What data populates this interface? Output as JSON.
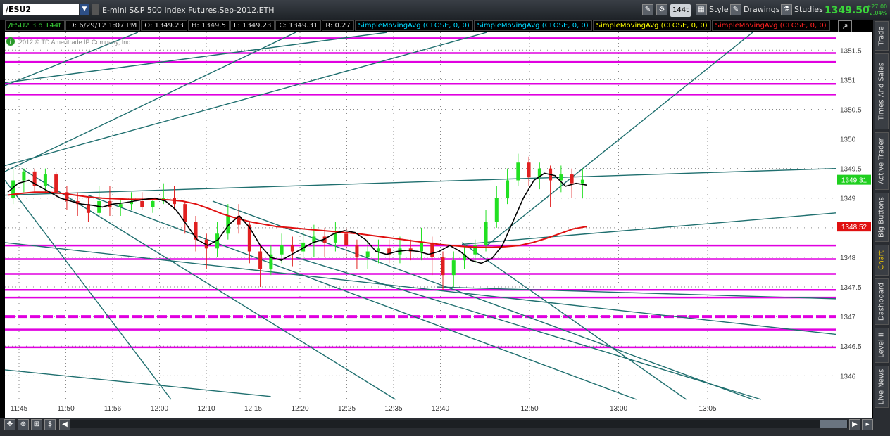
{
  "header": {
    "symbol": "/ESU2",
    "description": "E-mini S&P 500 Index Futures,Sep-2012,ETH",
    "ticks_label": "144t",
    "style_label": "Style",
    "drawings_label": "Drawings",
    "studies_label": "Studies",
    "last_price": "1349.50",
    "change_abs": "+27.00",
    "change_pct": "+2.04%"
  },
  "info_bar": {
    "symbol_period": "/ESU2 3 d 144t",
    "date": "D: 6/29/12 1:07 PM",
    "open": "O: 1349.23",
    "high": "H: 1349.5",
    "low": "L: 1349.23",
    "close": "C: 1349.31",
    "range": "R: 0.27",
    "studies": [
      {
        "label": "SimpleMovingAvg (CLOSE, 0, 0)",
        "color": "#00d8ff"
      },
      {
        "label": "SimpleMovingAvg (CLOSE, 0, 0)",
        "color": "#00d8ff"
      },
      {
        "label": "SimpleMovingAvg (CLOSE, 0, 0)",
        "color": "#ffff00"
      },
      {
        "label": "SimpleMovingAvg (CLOSE, 0, 0)",
        "color": "#ff2020"
      }
    ]
  },
  "watermark": "2012 © TD Ameritrade IP Company, Inc.",
  "right_tabs": [
    "Trade",
    "Times And Sales",
    "Active Trader",
    "Big Buttons",
    "Chart",
    "Dashboard",
    "Level II",
    "Live News"
  ],
  "active_tab": "Chart",
  "chart_data": {
    "type": "candlestick",
    "ylim": [
      1345.6,
      1351.8
    ],
    "y_ticks": [
      "1351.5",
      "1351",
      "1350.5",
      "1350",
      "1349.5",
      "1349",
      "1348.5",
      "1348",
      "1347.5",
      "1347",
      "1346.5",
      "1346"
    ],
    "x_ticks": [
      "11:45",
      "11:50",
      "11:56",
      "12:00",
      "12:10",
      "12:15",
      "12:20",
      "12:25",
      "12:35",
      "12:40",
      "12:50",
      "13:00",
      "13:05"
    ],
    "price_tags": [
      {
        "label": "1349.31",
        "value": 1349.31,
        "color": "#1fcf1f"
      },
      {
        "label": "1348.52",
        "value": 1348.52,
        "color": "#e01010"
      }
    ],
    "horizontal_levels": [
      1351.7,
      1351.45,
      1351.3,
      1350.93,
      1350.75,
      1348.2,
      1347.97,
      1347.72,
      1347.45,
      1347.32,
      1347.0,
      1346.78,
      1346.48
    ],
    "dashed_level": 1347.0,
    "colors": {
      "up": "#22e022",
      "down": "#e02020",
      "sma_fast": "#000000",
      "sma_slow": "#e01010",
      "levels": "#e000e0",
      "trendlines": "#1f6f6f",
      "grid": "#8a8a8a",
      "background": "#ffffff"
    },
    "sma_fast": [
      1349.1,
      1349.25,
      1349.3,
      1349.2,
      1349.1,
      1349.0,
      1348.95,
      1348.9,
      1348.88,
      1348.85,
      1348.9,
      1348.92,
      1348.95,
      1348.98,
      1349.0,
      1348.95,
      1348.8,
      1348.55,
      1348.3,
      1348.2,
      1348.3,
      1348.55,
      1348.7,
      1348.5,
      1348.2,
      1348.0,
      1347.95,
      1348.05,
      1348.15,
      1348.25,
      1348.3,
      1348.4,
      1348.45,
      1348.42,
      1348.3,
      1348.1,
      1348.05,
      1348.1,
      1348.12,
      1348.1,
      1348.05,
      1348.1,
      1348.2,
      1348.1,
      1347.95,
      1347.9,
      1347.98,
      1348.2,
      1348.6,
      1349.0,
      1349.3,
      1349.42,
      1349.38,
      1349.2,
      1349.25,
      1349.22
    ],
    "sma_slow": [
      1349.05,
      1349.08,
      1349.1,
      1349.1,
      1349.08,
      1349.05,
      1349.02,
      1349.0,
      1348.99,
      1348.98,
      1348.98,
      1348.98,
      1348.97,
      1348.95,
      1348.9,
      1348.82,
      1348.73,
      1348.66,
      1348.6,
      1348.56,
      1348.52,
      1348.5,
      1348.48,
      1348.46,
      1348.44,
      1348.42,
      1348.4,
      1348.37,
      1348.34,
      1348.31,
      1348.28,
      1348.25,
      1348.22,
      1348.2,
      1348.18,
      1348.17,
      1348.17,
      1348.18,
      1348.2,
      1348.25,
      1348.32,
      1348.4,
      1348.48,
      1348.52
    ],
    "candles": [
      [
        1349.0,
        1349.3,
        1349.5,
        1348.9
      ],
      [
        1349.3,
        1349.45,
        1349.5,
        1349.1
      ],
      [
        1349.45,
        1349.2,
        1349.5,
        1349.1
      ],
      [
        1349.2,
        1349.4,
        1349.5,
        1349.1
      ],
      [
        1349.4,
        1349.1,
        1349.45,
        1349.0
      ],
      [
        1349.1,
        1348.95,
        1349.2,
        1348.8
      ],
      [
        1348.95,
        1348.9,
        1349.1,
        1348.7
      ],
      [
        1348.9,
        1348.75,
        1349.0,
        1348.6
      ],
      [
        1348.75,
        1348.95,
        1349.2,
        1348.7
      ],
      [
        1348.95,
        1348.85,
        1349.2,
        1348.7
      ],
      [
        1348.85,
        1348.9,
        1349.0,
        1348.7
      ],
      [
        1348.9,
        1348.95,
        1349.1,
        1348.8
      ],
      [
        1348.95,
        1348.85,
        1349.1,
        1348.8
      ],
      [
        1348.85,
        1348.95,
        1349.0,
        1348.75
      ],
      [
        1348.95,
        1349.0,
        1349.25,
        1348.9
      ],
      [
        1349.0,
        1348.9,
        1349.2,
        1348.8
      ],
      [
        1348.9,
        1348.6,
        1348.95,
        1348.4
      ],
      [
        1348.6,
        1348.3,
        1348.7,
        1348.1
      ],
      [
        1348.3,
        1348.15,
        1348.4,
        1347.8
      ],
      [
        1348.15,
        1348.4,
        1348.6,
        1348.0
      ],
      [
        1348.4,
        1348.7,
        1348.9,
        1348.3
      ],
      [
        1348.7,
        1348.55,
        1348.9,
        1348.4
      ],
      [
        1348.55,
        1348.1,
        1348.6,
        1347.9
      ],
      [
        1348.1,
        1347.8,
        1348.2,
        1347.5
      ],
      [
        1347.8,
        1348.05,
        1348.2,
        1347.7
      ],
      [
        1348.05,
        1348.2,
        1348.4,
        1347.9
      ],
      [
        1348.2,
        1348.1,
        1348.35,
        1347.85
      ],
      [
        1348.1,
        1348.25,
        1348.45,
        1347.95
      ],
      [
        1348.25,
        1348.35,
        1348.55,
        1348.0
      ],
      [
        1348.35,
        1348.25,
        1348.5,
        1348.0
      ],
      [
        1348.25,
        1348.4,
        1348.6,
        1348.1
      ],
      [
        1348.4,
        1348.2,
        1348.5,
        1348.0
      ],
      [
        1348.2,
        1348.0,
        1348.3,
        1347.8
      ],
      [
        1348.0,
        1348.1,
        1348.3,
        1347.8
      ],
      [
        1348.1,
        1348.15,
        1348.3,
        1347.9
      ],
      [
        1348.15,
        1348.05,
        1348.3,
        1347.9
      ],
      [
        1348.05,
        1348.15,
        1348.35,
        1347.9
      ],
      [
        1348.15,
        1348.1,
        1348.3,
        1347.95
      ],
      [
        1348.1,
        1348.25,
        1348.5,
        1347.95
      ],
      [
        1348.25,
        1348.0,
        1348.35,
        1347.7
      ],
      [
        1348.0,
        1347.7,
        1348.1,
        1347.45
      ],
      [
        1347.7,
        1347.95,
        1348.1,
        1347.5
      ],
      [
        1347.95,
        1348.05,
        1348.2,
        1347.8
      ],
      [
        1348.05,
        1348.2,
        1348.3,
        1347.9
      ],
      [
        1348.2,
        1348.6,
        1348.8,
        1348.1
      ],
      [
        1348.6,
        1349.0,
        1349.2,
        1348.5
      ],
      [
        1349.0,
        1349.3,
        1349.5,
        1348.9
      ],
      [
        1349.3,
        1349.6,
        1349.75,
        1349.2
      ],
      [
        1349.6,
        1349.35,
        1349.7,
        1349.2
      ],
      [
        1349.35,
        1349.5,
        1349.6,
        1349.15
      ],
      [
        1349.5,
        1349.3,
        1349.55,
        1348.85
      ],
      [
        1349.3,
        1349.4,
        1349.55,
        1349.1
      ],
      [
        1349.4,
        1349.25,
        1349.5,
        1349.0
      ],
      [
        1349.25,
        1349.31,
        1349.5,
        1349.0
      ]
    ]
  }
}
